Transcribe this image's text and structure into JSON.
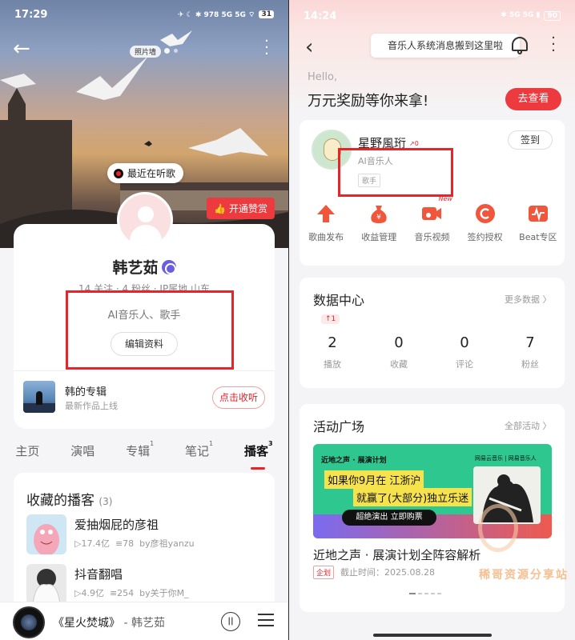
{
  "left": {
    "status_bar": {
      "time": "17:29",
      "icons": "✈ ☾ ✱ 978 5G 5G ⌔",
      "battery": "31"
    },
    "header": {
      "photo_tag": "照片墙"
    },
    "listening_bubble": "最近在听歌",
    "subscribe_button": "开通赞赏",
    "profile": {
      "name": "韩艺茹",
      "stats": "14 关注 · 4 粉丝 · IP属地 山东",
      "tags": "AI音乐人、歌手",
      "edit_button": "编辑资料"
    },
    "album": {
      "title": "韩的专辑",
      "subtitle": "最新作品上线",
      "button": "点击收听"
    },
    "tabs": [
      {
        "label": "主页",
        "count": ""
      },
      {
        "label": "演唱",
        "count": ""
      },
      {
        "label": "专辑",
        "count": "1"
      },
      {
        "label": "笔记",
        "count": "1"
      },
      {
        "label": "播客",
        "count": "3"
      }
    ],
    "podcasts": {
      "title": "收藏的播客",
      "count": "(3)",
      "items": [
        {
          "name": "爱抽烟屁的彦祖",
          "plays": "▷17.4亿",
          "tracks": "78",
          "by": "by彦祖yanzu"
        },
        {
          "name": "抖音翻唱",
          "plays": "▷4.9亿",
          "tracks": "254",
          "by": "by关于你M_"
        }
      ]
    },
    "player": {
      "song": "《星火焚城》",
      "artist": " - 韩艺茹"
    }
  },
  "right": {
    "status_bar": {
      "time": "14:24",
      "battery": "90"
    },
    "notice": "音乐人系统消息搬到这里啦",
    "hello": "Hello,",
    "reward": "万元奖励等你来拿!",
    "go_button": "去查看",
    "artist": {
      "name": "星野風珩",
      "level": "0",
      "role": "AI音乐人",
      "tag": "歌手",
      "sign_button": "签到"
    },
    "functions": [
      {
        "label": "歌曲发布",
        "icon": "upload-arrow-icon",
        "new": ""
      },
      {
        "label": "收益管理",
        "icon": "money-bag-icon",
        "new": ""
      },
      {
        "label": "音乐视频",
        "icon": "video-camera-icon",
        "new": "New"
      },
      {
        "label": "签约授权",
        "icon": "contract-c-icon",
        "new": ""
      },
      {
        "label": "Beat专区",
        "icon": "beat-wave-icon",
        "new": ""
      }
    ],
    "data_center": {
      "title": "数据中心",
      "more": "更多数据 〉",
      "delta": "↑1",
      "stats": [
        {
          "value": "2",
          "label": "播放"
        },
        {
          "value": "0",
          "label": "收藏"
        },
        {
          "value": "0",
          "label": "评论"
        },
        {
          "value": "7",
          "label": "粉丝"
        }
      ]
    },
    "activity": {
      "title": "活动广场",
      "more": "全部活动 〉",
      "banner": {
        "title": "近地之声 · 展演计划",
        "logos": "网易云音乐 | 网易音乐人",
        "line1": "如果你9月在 江浙沪",
        "line2": "就赢了(大部分)独立乐迷",
        "button": "超绝演出 立即购票"
      },
      "name": "近地之声 · 展演计划全阵容解析",
      "tag": "企划",
      "deadline": "截止时间：2025.08.28",
      "watermark": "稀哥资源分享站"
    }
  }
}
